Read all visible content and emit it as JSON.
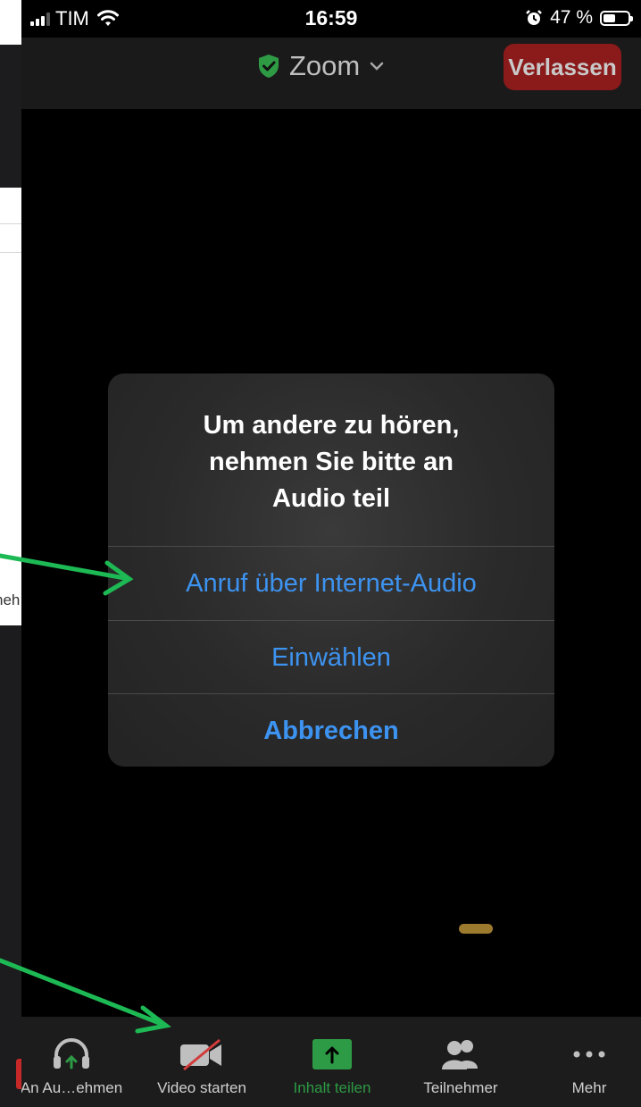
{
  "background_doc": {
    "snippet": "neh"
  },
  "status_bar": {
    "carrier": "TIM",
    "time": "16:59",
    "battery_percent": "47 %",
    "battery_level": 0.47
  },
  "header": {
    "title": "Zoom",
    "leave_label": "Verlassen",
    "shield_color": "#2e9a44"
  },
  "dialog": {
    "message": "Um andere zu hören,\nnehmen Sie bitte an\nAudio teil",
    "actions": [
      "Anruf über Internet-Audio",
      "Einwählen",
      "Abbrechen"
    ]
  },
  "toolbar": {
    "items": [
      {
        "label": "An Au…ehmen",
        "icon": "headphones-icon"
      },
      {
        "label": "Video starten",
        "icon": "video-off-icon"
      },
      {
        "label": "Inhalt teilen",
        "icon": "share-icon"
      },
      {
        "label": "Teilnehmer",
        "icon": "participants-icon"
      },
      {
        "label": "Mehr",
        "icon": "more-icon"
      }
    ]
  },
  "colors": {
    "accent_blue": "#3d93f0",
    "share_green": "#2d9a45",
    "leave_red": "#8b1a1a",
    "annotation_arrow": "#1db954"
  }
}
